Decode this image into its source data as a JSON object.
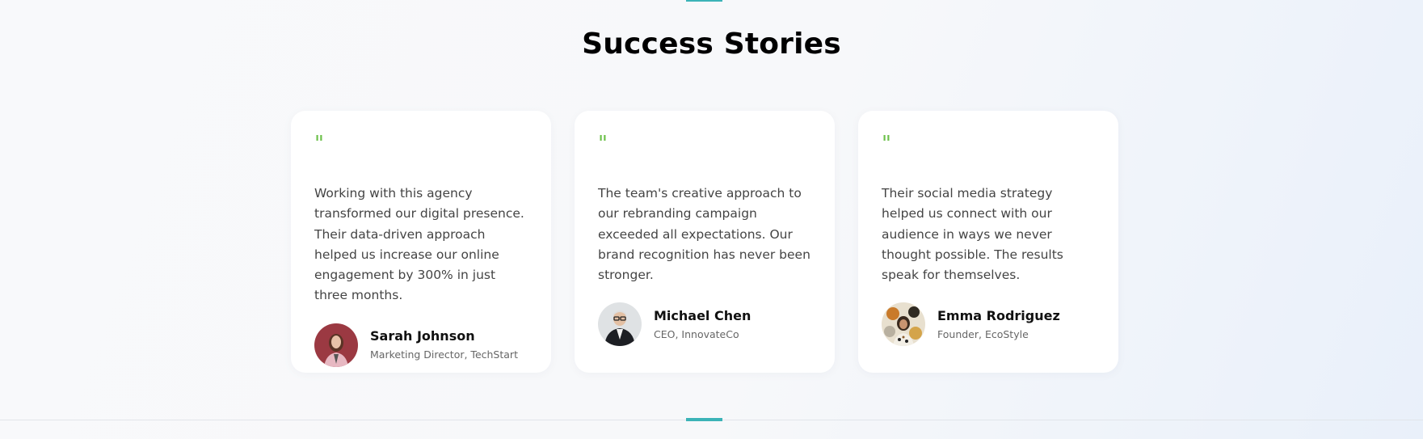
{
  "section": {
    "title": "Success Stories"
  },
  "colors": {
    "accent": "#3bb3b7",
    "quote_mark": "#6cc04a",
    "card_background": "#ffffff"
  },
  "testimonials": [
    {
      "quote_mark": "\"",
      "text": "Working with this agency transformed our digital presence. Their data-driven approach helped us increase our online engagement by 300% in just three months.",
      "name": "Sarah Johnson",
      "role": "Marketing Director, TechStart"
    },
    {
      "quote_mark": "\"",
      "text": "The team's creative approach to our rebranding campaign exceeded all expectations. Our brand recognition has never been stronger.",
      "name": "Michael Chen",
      "role": "CEO, InnovateCo"
    },
    {
      "quote_mark": "\"",
      "text": "Their social media strategy helped us connect with our audience in ways we never thought possible. The results speak for themselves.",
      "name": "Emma Rodriguez",
      "role": "Founder, EcoStyle"
    }
  ]
}
